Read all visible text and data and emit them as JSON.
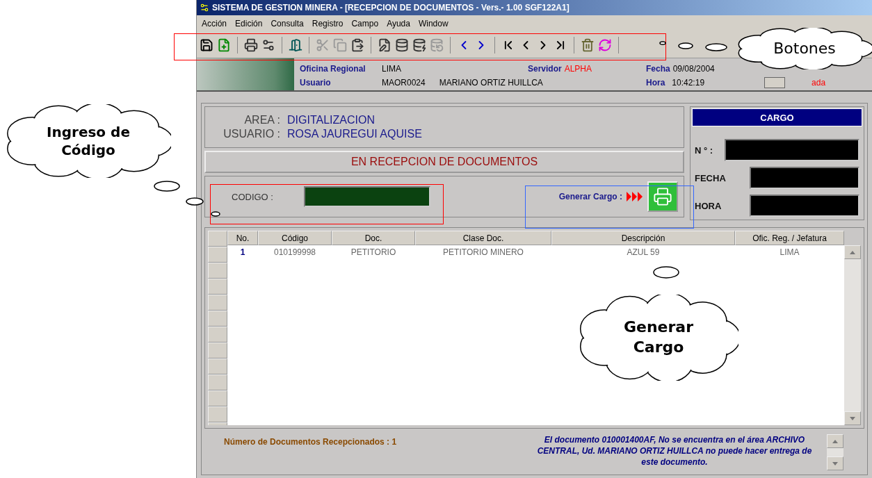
{
  "window": {
    "title": "SISTEMA DE GESTION MINERA - [RECEPCION DE DOCUMENTOS - Vers.- 1.00 SGF122A1]"
  },
  "menu": [
    "Acción",
    "Edición",
    "Consulta",
    "Registro",
    "Campo",
    "Ayuda",
    "Window"
  ],
  "header": {
    "oficina_label": "Oficina Regional",
    "oficina": "LIMA",
    "servidor_label": "Servidor",
    "servidor": "ALPHA",
    "fecha_label": "Fecha",
    "fecha": "09/08/2004",
    "usuario_label": "Usuario",
    "usuario_code": "MAOR0024",
    "usuario_name": "MARIANO ORTIZ HUILLCA",
    "hora_label": "Hora",
    "hora": "10:42:19",
    "status": "ada",
    "checked": false
  },
  "area": {
    "area_label": "AREA :",
    "area": "DIGITALIZACION",
    "usuario_label": "USUARIO :",
    "usuario": "ROSA JAUREGUI AQUISE",
    "banner": "EN RECEPCION DE DOCUMENTOS"
  },
  "codigo": {
    "label": "CODIGO :",
    "generar_label": "Generar Cargo :"
  },
  "cargo": {
    "title": "CARGO",
    "fields": [
      "N ° :",
      "FECHA",
      "HORA"
    ]
  },
  "table": {
    "columns": [
      "No.",
      "Código",
      "Doc.",
      "Clase Doc.",
      "Descripción",
      "Ofic. Reg. / Jefatura"
    ],
    "rows": [
      [
        "1",
        "010199998",
        "PETITORIO",
        "PETITORIO MINERO",
        "AZUL 59",
        "LIMA"
      ]
    ]
  },
  "footer": {
    "count_label": "Número de Documentos Recepcionados :",
    "count": "1",
    "message": "El documento 010001400AF, No se encuentra en el área ARCHIVO CENTRAL,  Ud. MARIANO ORTIZ HUILLCA no puede hacer entrega de este documento."
  },
  "callouts": [
    {
      "lines": [
        "Botones"
      ]
    },
    {
      "lines": [
        "Ingreso de",
        "Código"
      ]
    },
    {
      "lines": [
        "Generar",
        "Cargo"
      ]
    }
  ]
}
